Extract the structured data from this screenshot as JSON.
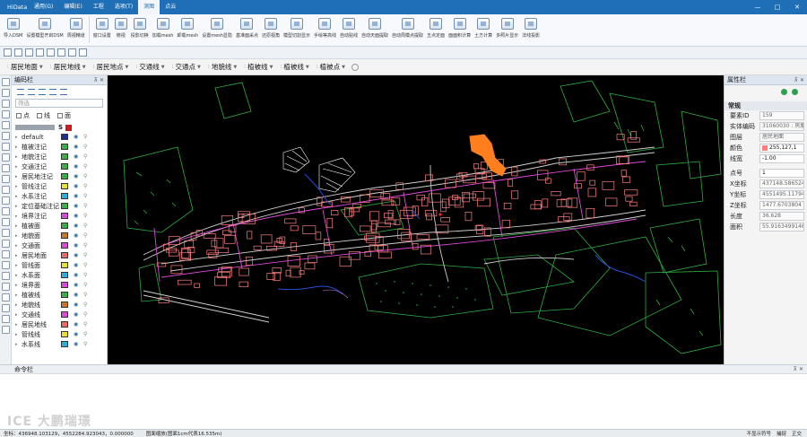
{
  "app_title": "HiData",
  "menu": [
    "通用(G)",
    "编辑(E)",
    "工程",
    "选项(T)",
    "测图",
    "点云"
  ],
  "active_menu": 4,
  "window_controls": [
    "—",
    "□",
    "✕"
  ],
  "ribbon": [
    {
      "label": "导入DSM"
    },
    {
      "label": "设置模型开启DSM"
    },
    {
      "label": "周视精道"
    },
    {
      "label": "窗口设置"
    },
    {
      "label": "俯视"
    },
    {
      "label": "投影切换"
    },
    {
      "label": "加载mesh"
    },
    {
      "label": "卸载mesh"
    },
    {
      "label": "设置mesh显隐"
    },
    {
      "label": "基准面采点"
    },
    {
      "label": "还原视角"
    },
    {
      "label": "模型切割显示"
    },
    {
      "label": "手绘等高线"
    },
    {
      "label": "自动贴线"
    },
    {
      "label": "自动天面提取"
    },
    {
      "label": "自动周模点提取"
    },
    {
      "label": "五点定面"
    },
    {
      "label": "面面积计算"
    },
    {
      "label": "土方计算"
    },
    {
      "label": "多照片显示"
    },
    {
      "label": "法线投影"
    }
  ],
  "layer_bar": [
    "居民地面",
    "居民地线",
    "居民地点",
    "交通线",
    "交通点",
    "地貌线",
    "植被线",
    "植被线",
    "植被点"
  ],
  "code_panel": {
    "title": "编码栏",
    "filter_placeholder": "筛选",
    "checks": [
      "点",
      "线",
      "面"
    ],
    "header_s": "S",
    "rows": [
      {
        "name": "default",
        "color": "#1e2f9a"
      },
      {
        "name": "植被注记",
        "color": "#3fae49"
      },
      {
        "name": "地貌注记",
        "color": "#3fae49"
      },
      {
        "name": "交通注记",
        "color": "#3fae49"
      },
      {
        "name": "居民地注记",
        "color": "#3fae49"
      },
      {
        "name": "管线注记",
        "color": "#e8e13a"
      },
      {
        "name": "水系注记",
        "color": "#2fb0d8"
      },
      {
        "name": "定位基础注记",
        "color": "#3fae49"
      },
      {
        "name": "境界注记",
        "color": "#d84bd8"
      },
      {
        "name": "植被面",
        "color": "#3fae49"
      },
      {
        "name": "地貌面",
        "color": "#c8782a"
      },
      {
        "name": "交通面",
        "color": "#d84bd8"
      },
      {
        "name": "居民地面",
        "color": "#e86a6a"
      },
      {
        "name": "管线面",
        "color": "#e8e13a"
      },
      {
        "name": "水系面",
        "color": "#2fb0d8"
      },
      {
        "name": "境界面",
        "color": "#d84bd8"
      },
      {
        "name": "植被线",
        "color": "#3fae49"
      },
      {
        "name": "地貌线",
        "color": "#c8782a"
      },
      {
        "name": "交通线",
        "color": "#d84bd8"
      },
      {
        "name": "居民地线",
        "color": "#e86a6a"
      },
      {
        "name": "管线线",
        "color": "#e8e13a"
      },
      {
        "name": "水系线",
        "color": "#2fb0d8"
      }
    ]
  },
  "prop_panel": {
    "title": "属性栏",
    "section": "常规",
    "rows": [
      {
        "k": "要素ID",
        "v": "159"
      },
      {
        "k": "实体编码",
        "v": "31060030 : 房屋"
      },
      {
        "k": "图层",
        "v": "居民地面"
      },
      {
        "k": "颜色",
        "v": "255,127,1"
      },
      {
        "k": "线宽",
        "v": "-1.00"
      },
      {
        "k": "点号",
        "v": "1"
      },
      {
        "k": "X坐标",
        "v": "437148.5865245"
      },
      {
        "k": "Y坐标",
        "v": "4551495.117940"
      },
      {
        "k": "Z坐标",
        "v": "1477.6703804"
      },
      {
        "k": "长度",
        "v": "36.628"
      },
      {
        "k": "面积",
        "v": "55.9163499146"
      }
    ]
  },
  "command": {
    "title": "命令栏",
    "watermark": "ICE 大鹏瑞璟"
  },
  "status": {
    "coords": "坐标：436948.103129，4552284.923043，0.000000",
    "scale": "图面缩放(图面1cm代表16.535m)",
    "right": [
      "不显示符号",
      "捕捉",
      "正交"
    ]
  }
}
